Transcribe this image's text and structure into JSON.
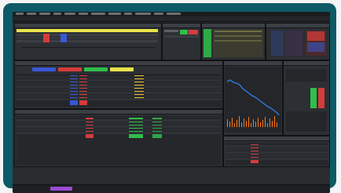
{
  "app": {
    "accent": "#0d5a66",
    "panel_bg": "#2c2f33",
    "positive": "#2fbf4a",
    "negative": "#d63b3b",
    "highlight": "#f1c232"
  },
  "panels": {
    "top_left": {
      "name": "market-depth-top-left"
    },
    "top_middle": {
      "name": "order-entry"
    },
    "top_right_1": {
      "name": "quotes-grid"
    },
    "top_right_2": {
      "name": "quotes-grid-2"
    },
    "center_left": {
      "name": "positions-table"
    },
    "center_chart": {
      "name": "price-chart"
    },
    "right_mini": {
      "name": "summary-panel"
    },
    "bottom_left": {
      "name": "orders-table"
    },
    "bottom_right": {
      "name": "trades-table"
    }
  },
  "chart": {
    "line_color": "#2f7de1",
    "bar_color": "#ff7a1a"
  }
}
